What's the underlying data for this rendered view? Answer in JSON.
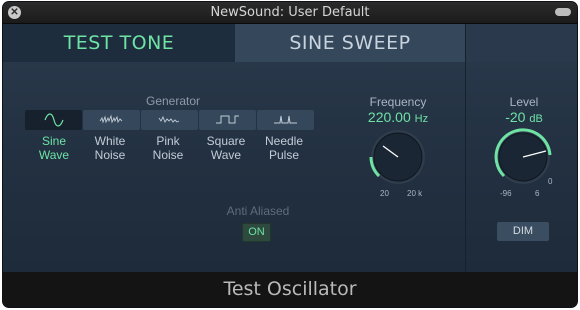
{
  "window": {
    "title": "NewSound: User Default"
  },
  "tabs": [
    {
      "label": "TEST TONE",
      "active": true
    },
    {
      "label": "SINE SWEEP",
      "active": false
    }
  ],
  "generator": {
    "label": "Generator",
    "selected": "Sine Wave",
    "buttons": [
      {
        "line1": "Sine",
        "line2": "Wave",
        "icon": "sine-wave-icon"
      },
      {
        "line1": "White",
        "line2": "Noise",
        "icon": "white-noise-icon"
      },
      {
        "line1": "Pink",
        "line2": "Noise",
        "icon": "pink-noise-icon"
      },
      {
        "line1": "Square",
        "line2": "Wave",
        "icon": "square-wave-icon"
      },
      {
        "line1": "Needle",
        "line2": "Pulse",
        "icon": "needle-pulse-icon"
      }
    ]
  },
  "frequency": {
    "label": "Frequency",
    "value": "220.00",
    "unit": "Hz",
    "min_label": "20",
    "max_label": "20 k"
  },
  "level": {
    "label": "Level",
    "value": "-20",
    "unit": "dB",
    "min_label": "-96",
    "mid_label": "6",
    "max_label": "0"
  },
  "anti_aliased": {
    "label": "Anti Aliased",
    "button": "ON"
  },
  "dim": {
    "label": "DIM"
  },
  "footer": {
    "label": "Test Oscillator"
  },
  "colors": {
    "accent": "#6ee3a4",
    "panel": "#223041",
    "tab_inactive": "#34475b",
    "footer": "#141414"
  }
}
